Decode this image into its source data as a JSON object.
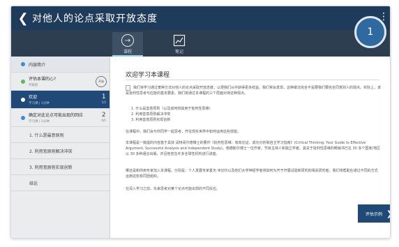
{
  "header": {
    "title": "对他人的论点采取开放态度"
  },
  "toolbar": {
    "buttons": [
      {
        "label": "课程"
      },
      {
        "label": "笔记"
      }
    ]
  },
  "progress": {
    "value": "1"
  },
  "sidebar": {
    "intro": "内容简介",
    "lessons": [
      {
        "title": "评估本课的心?",
        "meta": "开始前",
        "badge": "开始"
      },
      {
        "title": "欢迎",
        "meta": "学习课 | 1分钟",
        "count": "1",
        "count_sub": "1/2"
      },
      {
        "title": "确定对此论点可能出现的回应",
        "meta": "学习课 | 2分钟",
        "count": "2",
        "count_sub": "0/1"
      }
    ],
    "sub_items": [
      "1. 什么是最意原则",
      "2. 利用宽原则解决冲突",
      "3. 利用宽原则实现创新",
      "结论"
    ]
  },
  "main": {
    "heading": "欢迎学习本课程",
    "intro_text": "我们将学习通过宽种方法对他人的论点采取开放态度，以便我们从中获得更多收益。我们常会发现，这种做法完全不是要我们要完全同意别人的观点。实际上，该是批判性思考与应能的基本要素。我们将通过本课程的三个层面对待这种观点。",
    "list": [
      "1. 什么是善意原则（以及如何将其用于批判性思维）",
      "2. 利用善意原则解决冲突",
      "3. 利用善意原则实现创新"
    ],
    "p2": "在课程中，我们会与你同学一起思考，开在现实世界中如何运用这些技能。",
    "p3": "本课程是一篇提的内容基于具体 请特哥尔德博士的著作《批判性思维：有效论证、成功分析和自主学习指南》(Critical Thinking: Your Guide to Effective Argument, Successful Analysis and Independent Study)。南德斯尔博士一位作家、节目主持人和独立学者。其关于批判性思维的畅销书已在 30 多个国家/地区以 30 多种语言出版，并且他曾在许多全球性机构进行讲座。",
    "p4": "哪还是和你用专家加入本课程。分别是：个人发展专家夏天·米切尔以及他们大学神经学者将如何为开于开展试验新研究的相关研究者。我们将帮助在通过不同的方式运用这些有同团组织。",
    "p5": "在深入学习之前，先来思考对某个论点可能出现的不同反应。",
    "cta": "评估示例"
  },
  "colors": {
    "header": "#1f3b5c",
    "toolbar": "#2d3e50",
    "accent": "#1f4a78"
  }
}
